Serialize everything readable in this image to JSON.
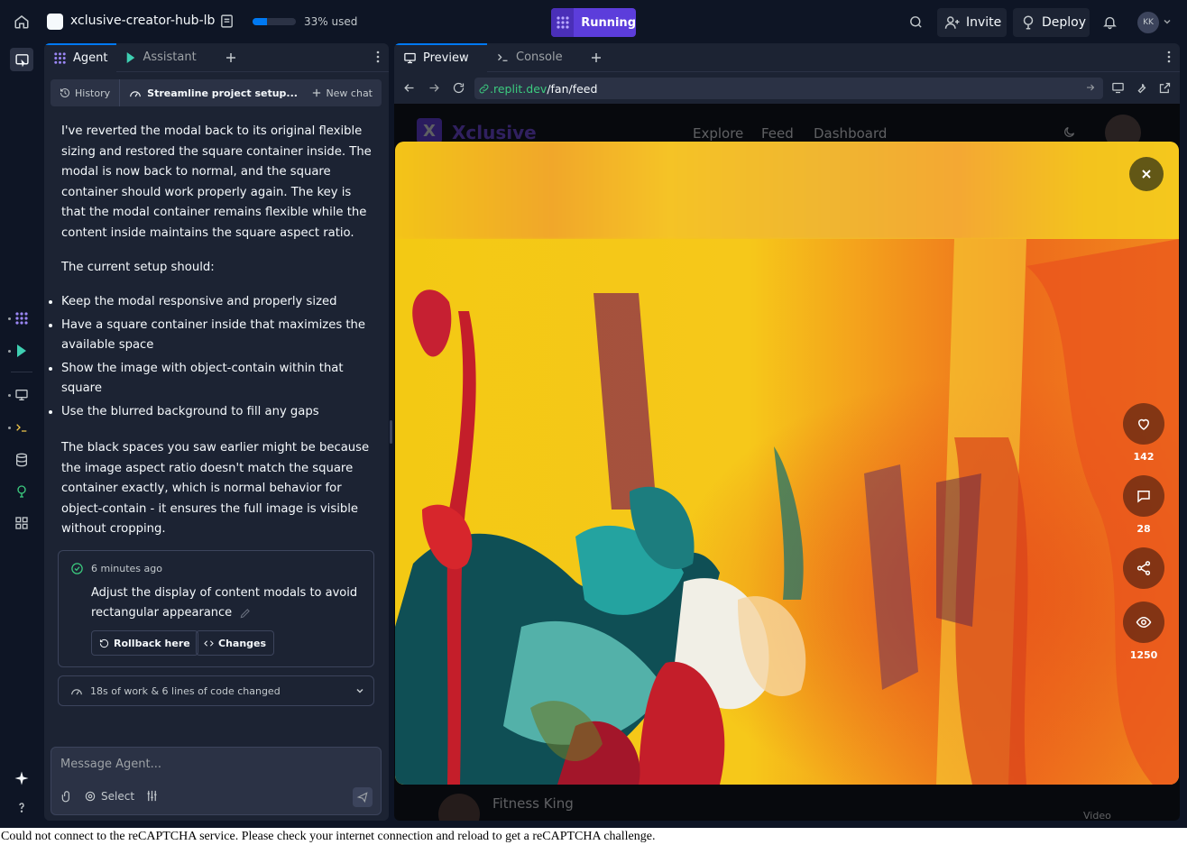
{
  "topbar": {
    "repl_name": "xclusive-creator-hub-lb",
    "storage_used_label": "33% used",
    "storage_used_fraction": 0.33,
    "run_label": "Running",
    "invite_label": "Invite",
    "deploy_label": "Deploy",
    "avatar_initials": "KK"
  },
  "agent_pane": {
    "tabs": [
      {
        "label": "Agent",
        "icon": "agent-icon",
        "active": true
      },
      {
        "label": "Assistant",
        "icon": "assistant-icon",
        "active": false
      }
    ],
    "chat_header": {
      "history_label": "History",
      "chat_title": "Streamline project setup...",
      "new_chat_label": "New chat"
    },
    "message": {
      "para1": "I've reverted the modal back to its original flexible sizing and restored the square container inside. The modal is now back to normal, and the square container should work properly again. The key is that the modal container remains flexible while the content inside maintains the square aspect ratio.",
      "para2": "The current setup should:",
      "bullets": [
        "Keep the modal responsive and properly sized",
        "Have a square container inside that maximizes the available space",
        "Show the image with object-contain within that square",
        "Use the blurred background to fill any gaps"
      ],
      "para3": "The black spaces you saw earlier might be because the image aspect ratio doesn't match the square container exactly, which is normal behavior for object-contain - it ensures the full image is visible without cropping."
    },
    "checkpoint": {
      "time": "6 minutes ago",
      "text": "Adjust the display of content modals to avoid rectangular appearance",
      "rollback_label": "Rollback here",
      "changes_label": "Changes"
    },
    "work_summary": "18s of work & 6 lines of code changed",
    "composer": {
      "placeholder": "Message Agent...",
      "select_label": "Select"
    }
  },
  "preview_pane": {
    "tabs": [
      {
        "label": "Preview",
        "active": true
      },
      {
        "label": "Console",
        "active": false
      }
    ],
    "url_prefix": ".replit.dev",
    "url_path": "/fan/feed",
    "site": {
      "logo_letter": "X",
      "logo_text": "Xclusive",
      "nav_links": [
        "Explore",
        "Feed",
        "Dashboard"
      ],
      "creator_name": "Fitness King",
      "content_type": "Video"
    },
    "modal": {
      "likes": "142",
      "comments": "28",
      "views": "1250"
    }
  },
  "status_message": "Could not connect to the reCAPTCHA service. Please check your internet connection and reload to get a reCAPTCHA challenge."
}
